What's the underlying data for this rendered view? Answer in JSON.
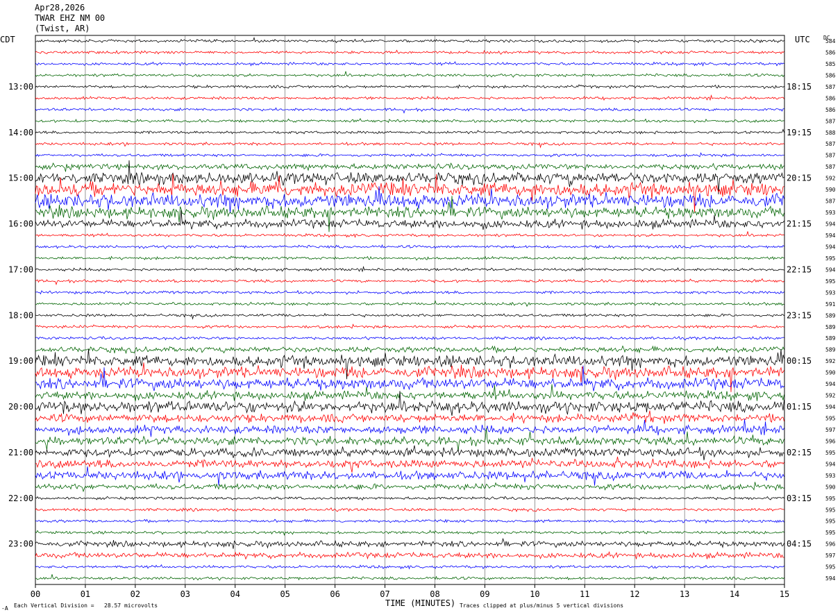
{
  "header": {
    "date": "Apr28,2026",
    "station": "TWAR EHZ NM 00",
    "location": "(Twist, AR)"
  },
  "left_tz": "CDT",
  "right_tz": "UTC",
  "dc_label": "DC",
  "footer": {
    "marker": "-A",
    "scale_text": "Each Vertical Division =   28.57 microvolts",
    "clip_text": "Traces clipped at plus/minus 5 vertical divisions"
  },
  "colors": {
    "black": "#000000",
    "red": "#ff0000",
    "blue": "#0000ff",
    "green": "#006400",
    "grid": "#000000"
  },
  "chart_data": {
    "type": "line",
    "title": "TWAR EHZ NM 00 (Twist, AR) Apr28,2026",
    "xlabel": "TIME (MINUTES)",
    "xlim": [
      0,
      15
    ],
    "x_ticks": [
      "00",
      "01",
      "02",
      "03",
      "04",
      "05",
      "06",
      "07",
      "08",
      "09",
      "10",
      "11",
      "12",
      "13",
      "14",
      "15"
    ],
    "left_hour_labels": [
      "13:00",
      "14:00",
      "15:00",
      "16:00",
      "17:00",
      "18:00",
      "19:00",
      "20:00",
      "21:00",
      "22:00",
      "23:00"
    ],
    "right_hour_labels": [
      "18:15",
      "19:15",
      "20:15",
      "21:15",
      "22:15",
      "23:15",
      "00:15",
      "01:15",
      "02:15",
      "03:15",
      "04:15"
    ],
    "trace_color_cycle": [
      "black",
      "red",
      "blue",
      "green"
    ],
    "dc_offsets": [
      584,
      586,
      585,
      586,
      587,
      586,
      586,
      587,
      588,
      587,
      587,
      587,
      592,
      590,
      587,
      593,
      594,
      594,
      594,
      595,
      594,
      595,
      593,
      591,
      589,
      589,
      589,
      589,
      592,
      590,
      594,
      592,
      594,
      595,
      597,
      596,
      595,
      594,
      593,
      590,
      595,
      595,
      595,
      595,
      596,
      597,
      595,
      594
    ],
    "trace_amplitude_level": [
      1,
      1,
      1,
      1,
      1,
      1,
      1,
      1,
      1,
      1,
      1,
      2,
      4,
      5,
      5,
      4,
      3,
      1,
      1,
      1,
      1,
      1,
      1,
      1,
      1,
      1,
      1,
      2,
      4,
      4,
      4,
      3,
      4,
      3,
      3,
      3,
      3,
      3,
      3,
      2,
      1,
      1,
      1,
      1,
      2,
      2,
      1,
      1
    ],
    "scale_microvolts_per_division": 28.57,
    "clip_divisions": 5
  }
}
